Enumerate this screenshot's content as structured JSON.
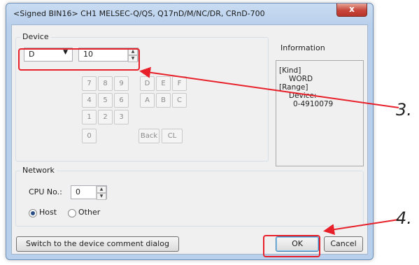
{
  "window": {
    "title": "<Signed BIN16> CH1 MELSEC-Q/QS, Q17nD/M/NC/DR, CRnD-700",
    "close_label": "x"
  },
  "device": {
    "group_label": "Device",
    "type_value": "D",
    "number_value": "10",
    "keypad": {
      "digits": [
        "7",
        "8",
        "9",
        "4",
        "5",
        "6",
        "1",
        "2",
        "3",
        "0"
      ],
      "hex": [
        "D",
        "E",
        "F",
        "A",
        "B",
        "C"
      ],
      "back_label": "Back",
      "clear_label": "CL"
    }
  },
  "information": {
    "title": "Information",
    "lines": [
      "[Kind]",
      "WORD",
      "[Range]",
      "Device:",
      "0-4910079"
    ]
  },
  "network": {
    "group_label": "Network",
    "cpu_label": "CPU No.:",
    "cpu_value": "0",
    "host_label": "Host",
    "other_label": "Other",
    "selected": "Host"
  },
  "buttons": {
    "switch_label": "Switch to the device comment dialog",
    "ok_label": "OK",
    "cancel_label": "Cancel"
  },
  "annotations": {
    "step3": "3.",
    "step4": "4.",
    "color": "#e8202a"
  }
}
